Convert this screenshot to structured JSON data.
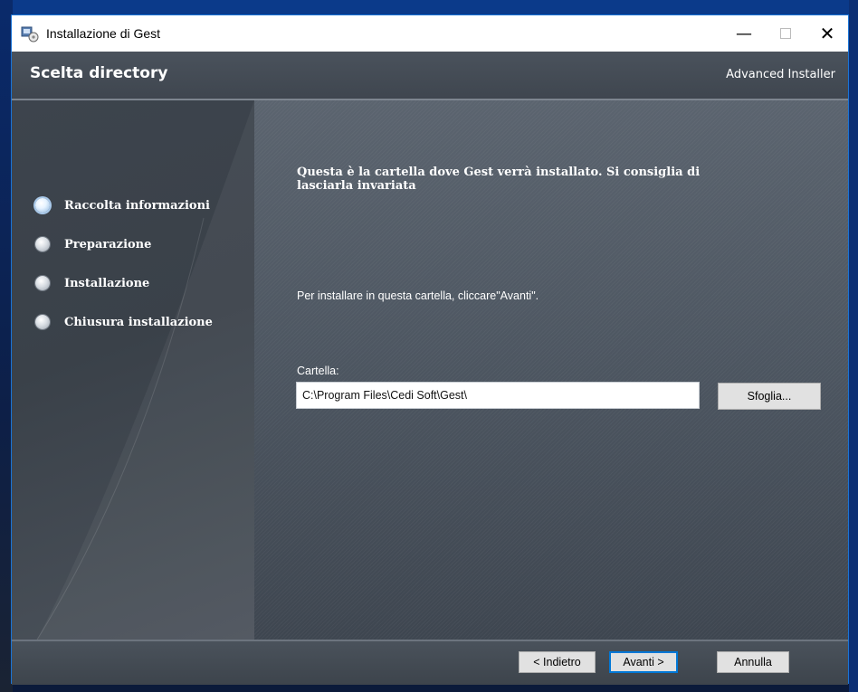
{
  "window": {
    "title": "Installazione di Gest"
  },
  "header": {
    "title": "Scelta directory",
    "brand": "Advanced Installer"
  },
  "sidebar": {
    "steps": [
      {
        "label": "Raccolta informazioni",
        "active": true
      },
      {
        "label": "Preparazione",
        "active": false
      },
      {
        "label": "Installazione",
        "active": false
      },
      {
        "label": "Chiusura installazione",
        "active": false
      }
    ]
  },
  "main": {
    "heading": "Questa è la cartella dove Gest verrà installato. Si consiglia di lasciarla invariata",
    "instruction": "Per installare in questa cartella, cliccare\"Avanti\".",
    "folder_label": "Cartella:",
    "folder_value": "C:\\Program Files\\Cedi Soft\\Gest\\",
    "browse_label": "Sfoglia..."
  },
  "footer": {
    "back_label": "< Indietro",
    "next_label": "Avanti >",
    "cancel_label": "Annulla"
  },
  "icons": {
    "app": "installer-package-icon",
    "minimize": "minimize-icon",
    "maximize": "maximize-icon",
    "close": "close-icon"
  },
  "colors": {
    "accent": "#0078d7",
    "header_bg": "#454c55",
    "content_bg": "#505964"
  }
}
